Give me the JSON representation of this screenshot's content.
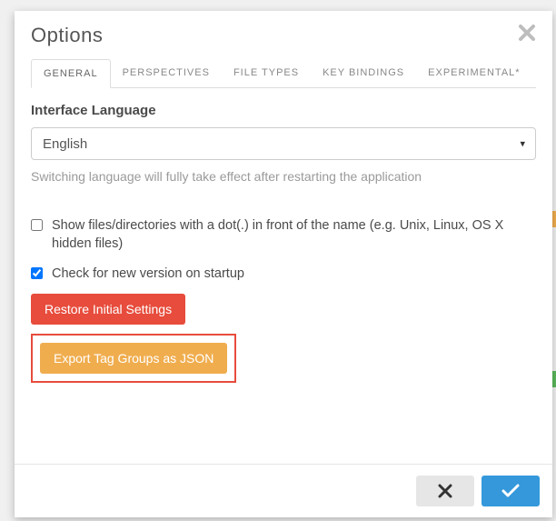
{
  "modal": {
    "title": "Options",
    "tabs": [
      {
        "label": "GENERAL",
        "active": true
      },
      {
        "label": "PERSPECTIVES",
        "active": false
      },
      {
        "label": "FILE TYPES",
        "active": false
      },
      {
        "label": "KEY BINDINGS",
        "active": false
      },
      {
        "label": "EXPERIMENTAL*",
        "active": false
      }
    ],
    "general": {
      "language_label": "Interface Language",
      "language_value": "English",
      "language_help": "Switching language will fully take effect after restarting the application",
      "show_hidden": {
        "checked": false,
        "label": "Show files/directories with a dot(.) in front of the name (e.g. Unix, Linux, OS X hidden files)"
      },
      "check_update": {
        "checked": true,
        "label": "Check for new version on startup"
      },
      "restore_button": "Restore Initial Settings",
      "export_button": "Export Tag Groups as JSON"
    }
  }
}
